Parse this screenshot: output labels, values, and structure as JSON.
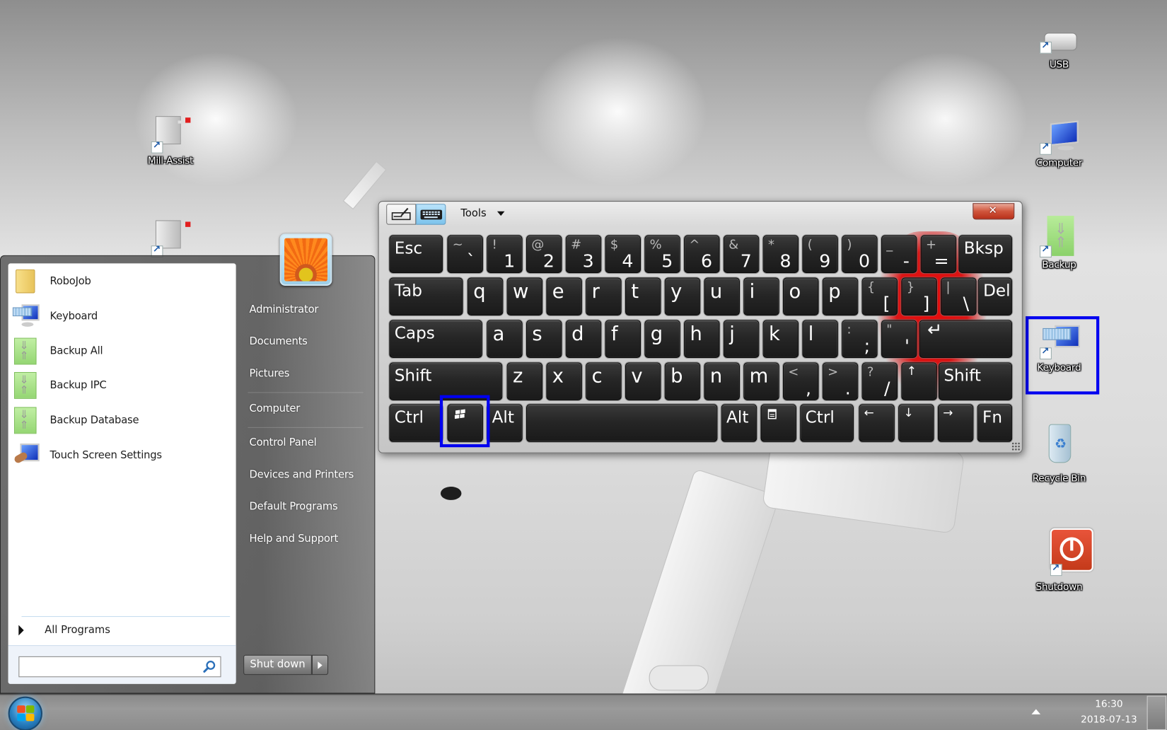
{
  "desktop": {
    "icons_left": [
      {
        "label": "Mill-Assist",
        "icon": "robot-cell-icon"
      },
      {
        "label": "",
        "icon": "robot-cell-icon"
      }
    ],
    "icons_right": [
      {
        "label": "USB",
        "icon": "usb-drive-icon"
      },
      {
        "label": "Computer",
        "icon": "computer-icon"
      },
      {
        "label": "Backup",
        "icon": "backup-icon"
      },
      {
        "label": "Keyboard",
        "icon": "keyboard-icon",
        "highlighted": true
      },
      {
        "label": "Recycle Bin",
        "icon": "recycle-bin-icon"
      },
      {
        "label": "Shutdown",
        "icon": "power-icon"
      }
    ],
    "highlight_color": "#0000f0"
  },
  "start_menu": {
    "programs": [
      {
        "label": "RoboJob",
        "icon": "folder-icon"
      },
      {
        "label": "Keyboard",
        "icon": "keyboard-icon"
      },
      {
        "label": "Backup All",
        "icon": "backup-icon"
      },
      {
        "label": "Backup IPC",
        "icon": "backup-icon"
      },
      {
        "label": "Backup Database",
        "icon": "backup-icon"
      },
      {
        "label": "Touch Screen Settings",
        "icon": "touch-screen-icon"
      }
    ],
    "all_programs": "All Programs",
    "search": {
      "value": "",
      "placeholder": ""
    },
    "right_links": [
      "Administrator",
      "Documents",
      "Pictures",
      "Computer",
      "Control Panel",
      "Devices and Printers",
      "Default Programs",
      "Help and Support"
    ],
    "shutdown_label": "Shut down"
  },
  "taskbar": {
    "time": "16:30",
    "date": "2018-07-13"
  },
  "osk": {
    "tools_label": "Tools",
    "rows": [
      [
        {
          "main": "Esc"
        },
        {
          "shift": "~",
          "main": "`"
        },
        {
          "shift": "!",
          "main": "1"
        },
        {
          "shift": "@",
          "main": "2"
        },
        {
          "shift": "#",
          "main": "3"
        },
        {
          "shift": "$",
          "main": "4"
        },
        {
          "shift": "%",
          "main": "5"
        },
        {
          "shift": "^",
          "main": "6"
        },
        {
          "shift": "&",
          "main": "7"
        },
        {
          "shift": "*",
          "main": "8"
        },
        {
          "shift": "(",
          "main": "9"
        },
        {
          "shift": ")",
          "main": "0"
        },
        {
          "shift": "_",
          "main": "-"
        },
        {
          "shift": "+",
          "main": "="
        },
        {
          "main": "Bksp"
        }
      ],
      [
        {
          "main": "Tab"
        },
        {
          "main": "q"
        },
        {
          "main": "w"
        },
        {
          "main": "e"
        },
        {
          "main": "r"
        },
        {
          "main": "t"
        },
        {
          "main": "y"
        },
        {
          "main": "u"
        },
        {
          "main": "i"
        },
        {
          "main": "o"
        },
        {
          "main": "p"
        },
        {
          "shift": "{",
          "main": "["
        },
        {
          "shift": "}",
          "main": "]"
        },
        {
          "shift": "|",
          "main": "\\"
        },
        {
          "main": "Del"
        }
      ],
      [
        {
          "main": "Caps"
        },
        {
          "main": "a"
        },
        {
          "main": "s"
        },
        {
          "main": "d"
        },
        {
          "main": "f"
        },
        {
          "main": "g"
        },
        {
          "main": "h"
        },
        {
          "main": "j"
        },
        {
          "main": "k"
        },
        {
          "main": "l"
        },
        {
          "shift": ":",
          "main": ";"
        },
        {
          "shift": "\"",
          "main": "'"
        },
        {
          "main": "↵"
        }
      ],
      [
        {
          "main": "Shift"
        },
        {
          "main": "z"
        },
        {
          "main": "x"
        },
        {
          "main": "c"
        },
        {
          "main": "v"
        },
        {
          "main": "b"
        },
        {
          "main": "n"
        },
        {
          "main": "m"
        },
        {
          "shift": "<",
          "main": ","
        },
        {
          "shift": ">",
          "main": "."
        },
        {
          "shift": "?",
          "main": "/"
        },
        {
          "main": "↑"
        },
        {
          "main": "Shift"
        }
      ],
      [
        {
          "main": "Ctrl"
        },
        {
          "main": "",
          "icon": "windows-logo-icon",
          "highlighted": true
        },
        {
          "main": "Alt"
        },
        {
          "main": ""
        },
        {
          "main": "Alt"
        },
        {
          "main": "",
          "icon": "context-menu-icon"
        },
        {
          "main": "Ctrl"
        },
        {
          "main": "←"
        },
        {
          "main": "↓"
        },
        {
          "main": "→"
        },
        {
          "main": "Fn"
        }
      ]
    ]
  }
}
